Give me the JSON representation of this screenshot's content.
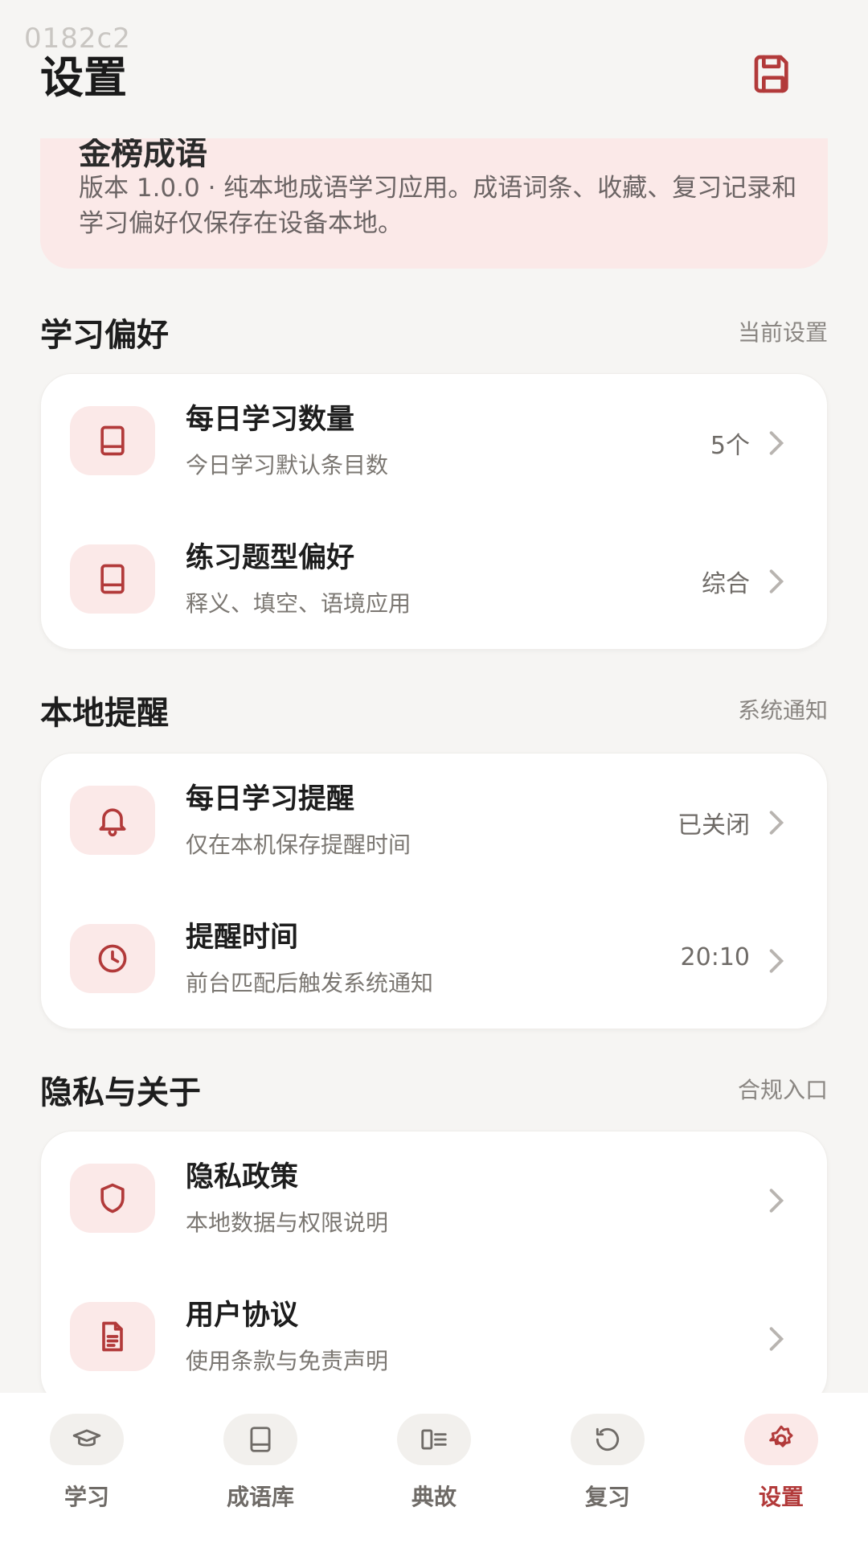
{
  "watermark": "0182c2",
  "header": {
    "title": "设置",
    "save_icon": "save-icon"
  },
  "about": {
    "title": "金榜成语",
    "description": "版本 1.0.0 · 纯本地成语学习应用。成语词条、收藏、复习记录和学习偏好仅保存在设备本地。"
  },
  "sections": {
    "study": {
      "title": "学习偏好",
      "hint": "当前设置",
      "items": [
        {
          "title": "每日学习数量",
          "subtitle": "今日学习默认条目数",
          "value": "5个",
          "icon": "book-icon"
        },
        {
          "title": "练习题型偏好",
          "subtitle": "释义、填空、语境应用",
          "value": "综合",
          "icon": "book-icon"
        }
      ]
    },
    "reminder": {
      "title": "本地提醒",
      "hint": "系统通知",
      "items": [
        {
          "title": "每日学习提醒",
          "subtitle": "仅在本机保存提醒时间",
          "value": "已关闭",
          "icon": "bell-icon"
        },
        {
          "title": "提醒时间",
          "subtitle": "前台匹配后触发系统通知",
          "value": "20:10",
          "icon": "clock-icon"
        }
      ]
    },
    "privacy": {
      "title": "隐私与关于",
      "hint": "合规入口",
      "items": [
        {
          "title": "隐私政策",
          "subtitle": "本地数据与权限说明",
          "value": "",
          "icon": "shield-icon"
        },
        {
          "title": "用户协议",
          "subtitle": "使用条款与免责声明",
          "value": "",
          "icon": "document-icon"
        }
      ]
    }
  },
  "nav": [
    {
      "label": "学习",
      "icon": "graduation-cap-icon"
    },
    {
      "label": "成语库",
      "icon": "book-icon"
    },
    {
      "label": "典故",
      "icon": "reading-icon"
    },
    {
      "label": "复习",
      "icon": "refresh-icon"
    },
    {
      "label": "设置",
      "icon": "gear-icon",
      "active": true
    }
  ],
  "colors": {
    "accent": "#b23a3a",
    "accent_soft": "#fbe9e8",
    "background": "#f6f5f3"
  }
}
